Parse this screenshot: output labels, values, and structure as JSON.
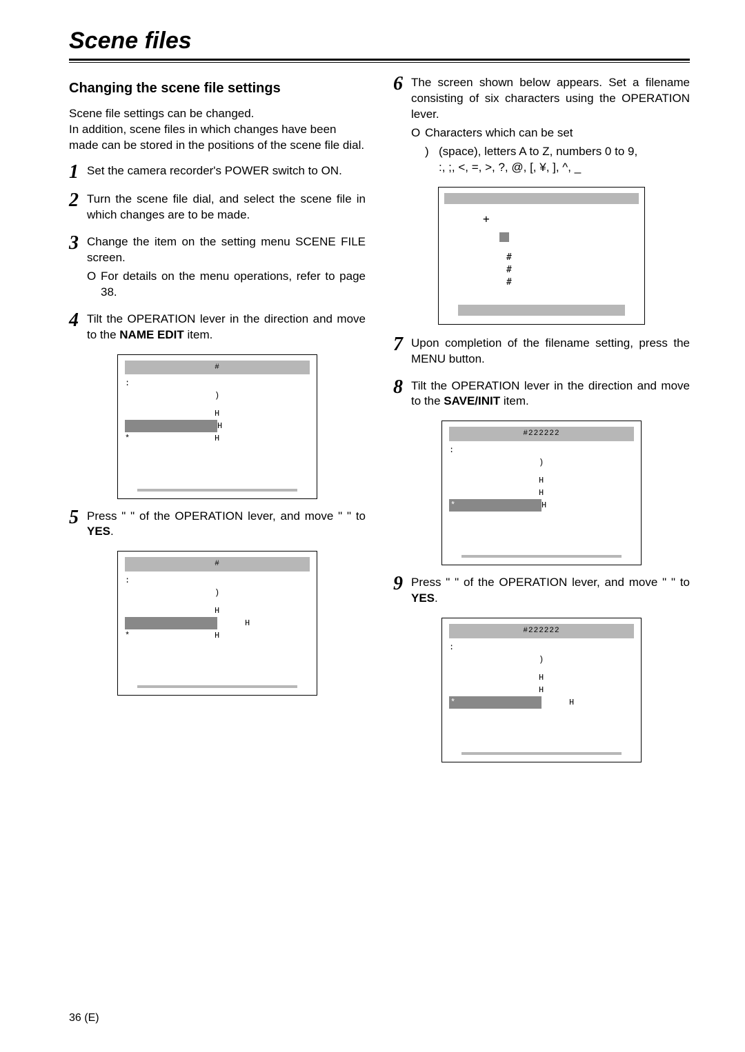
{
  "page_title": "Scene files",
  "section_title": "Changing the scene file settings",
  "intro_line1": "Scene file settings can be changed.",
  "intro_line2": "In addition, scene files in which changes have been made can be stored in the positions of the scene file dial.",
  "steps": {
    "s1": "Set the camera recorder's POWER switch to ON.",
    "s2": "Turn the scene file dial, and select the scene file in which changes are to be made.",
    "s3_main": "Change the item on the setting menu SCENE FILE screen.",
    "s3_bullet": "For details on the menu operations, refer to page 38.",
    "s4_a": "Tilt the OPERATION lever in the ",
    "s4_b": " direction and move to the ",
    "s4_bold": "NAME EDIT",
    "s4_c": " item.",
    "s5_a": "Press \"",
    "s5_b": "\" of the OPERATION lever, and move \"",
    "s5_c": "\" to ",
    "s5_bold": "YES",
    "s5_d": ".",
    "s6_a": "The screen shown below appears.  Set a filename consisting of six characters using the OPERATION lever.",
    "s6_bullet_label": "Characters which can be set",
    "s6_chars_line1": "(space), letters A to Z, numbers 0 to 9,",
    "s6_chars_line2": ":, ;, <, =, >, ?, @, [, ¥, ], ^, _",
    "s7": "Upon completion of the filename setting, press the MENU button.",
    "s8_a": "Tilt the OPERATION lever in the ",
    "s8_b": " direction and move to the ",
    "s8_bold": "SAVE/INIT",
    "s8_c": " item.",
    "s9_a": "Press \"",
    "s9_b": "\" of the OPERATION lever, and move \"",
    "s9_c": "\" to ",
    "s9_bold": "YES",
    "s9_d": "."
  },
  "screens": {
    "scr4": {
      "title": "#",
      "r1_l": ":",
      "r1_v": "",
      "r2_l": "",
      "r2_v": ")",
      "r3_l": "",
      "r3_v": "H",
      "r4_l": "",
      "r4_v": "H",
      "r5_l": "*",
      "r5_v": "H",
      "bottom": ""
    },
    "scr5": {
      "title": "#",
      "r1_l": ":",
      "r1_v": "",
      "r2_l": "",
      "r2_v": ")",
      "r3_l": "",
      "r3_v": "H",
      "r4_l": "",
      "r4_v": "H",
      "r5_l": "*",
      "r5_v": "H",
      "bottom": ""
    },
    "scr6_plus": "+",
    "scr6_chars": "#\n#\n#",
    "scr8": {
      "title": "#222222",
      "r1_l": ":",
      "r1_v": "",
      "r2_l": "",
      "r2_v": ")",
      "r3_l": "",
      "r3_v": "H",
      "r4_l": "",
      "r4_v": "H",
      "r5_l": "*",
      "r5_v": "H",
      "bottom": ""
    },
    "scr9": {
      "title": "#222222",
      "r1_l": ":",
      "r1_v": "",
      "r2_l": "",
      "r2_v": ")",
      "r3_l": "",
      "r3_v": "H",
      "r4_l": "",
      "r4_v": "H",
      "r5_l": "*",
      "r5_v": "H",
      "bottom": ""
    }
  },
  "page_number": "36 (E)"
}
